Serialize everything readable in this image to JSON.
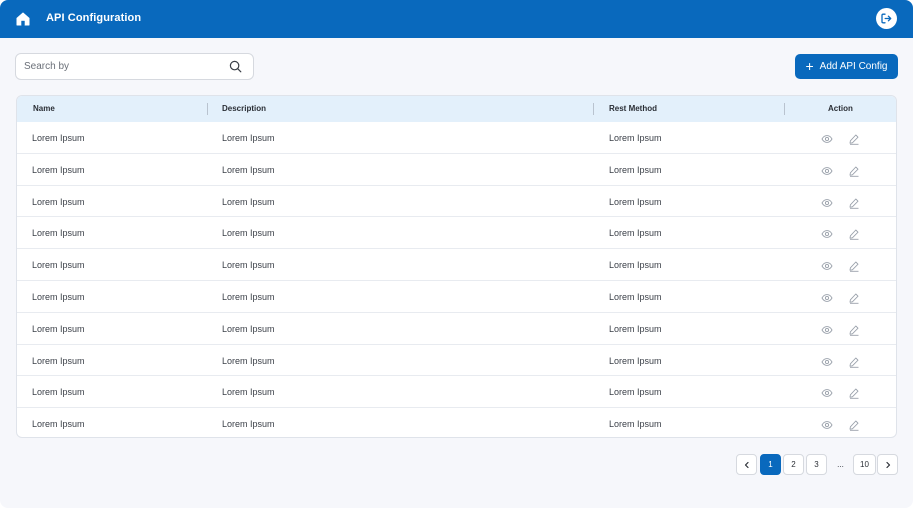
{
  "header": {
    "title": "API Configuration",
    "home_icon": "home-icon",
    "logout_icon": "logout-icon"
  },
  "search": {
    "placeholder": "Search by",
    "value": "",
    "icon": "search-icon"
  },
  "toolbar": {
    "add_label": "Add API Config",
    "add_icon": "plus-icon"
  },
  "table": {
    "columns": [
      "Name",
      "Description",
      "Rest Method",
      "Action"
    ],
    "rows": [
      {
        "name": "Lorem Ipsum",
        "description": "Lorem Ipsum",
        "method": "Lorem Ipsum"
      },
      {
        "name": "Lorem Ipsum",
        "description": "Lorem Ipsum",
        "method": "Lorem Ipsum"
      },
      {
        "name": "Lorem Ipsum",
        "description": "Lorem Ipsum",
        "method": "Lorem Ipsum"
      },
      {
        "name": "Lorem Ipsum",
        "description": "Lorem Ipsum",
        "method": "Lorem Ipsum"
      },
      {
        "name": "Lorem Ipsum",
        "description": "Lorem Ipsum",
        "method": "Lorem Ipsum"
      },
      {
        "name": "Lorem Ipsum",
        "description": "Lorem Ipsum",
        "method": "Lorem Ipsum"
      },
      {
        "name": "Lorem Ipsum",
        "description": "Lorem Ipsum",
        "method": "Lorem Ipsum"
      },
      {
        "name": "Lorem Ipsum",
        "description": "Lorem Ipsum",
        "method": "Lorem Ipsum"
      },
      {
        "name": "Lorem Ipsum",
        "description": "Lorem Ipsum",
        "method": "Lorem Ipsum"
      },
      {
        "name": "Lorem Ipsum",
        "description": "Lorem Ipsum",
        "method": "Lorem Ipsum"
      }
    ],
    "action_icons": [
      "eye-icon",
      "edit-icon"
    ]
  },
  "pagination": {
    "prev_icon": "chevron-left-icon",
    "next_icon": "chevron-right-icon",
    "pages": [
      "1",
      "2",
      "3",
      "...",
      "10"
    ],
    "current": "1"
  },
  "colors": {
    "primary": "#0969bd",
    "header_row": "#e3f0fb",
    "background": "#f6f7fb"
  }
}
